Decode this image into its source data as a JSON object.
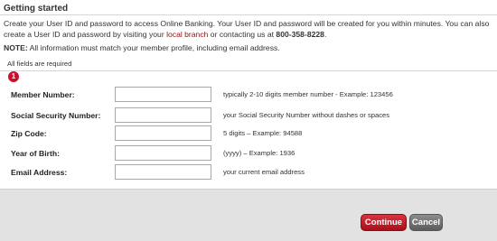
{
  "header": {
    "title": "Getting started"
  },
  "intro": {
    "text_before_link": "Create your User ID and password to access Online Banking. Your User ID and password will be created for you within minutes. You can also create a User ID and password by visiting your ",
    "link_text": "local branch",
    "text_after_link": " or contacting us at ",
    "phone": "800-358-8228",
    "end": "."
  },
  "note": {
    "label": "NOTE:",
    "text": " All information must match your member profile, including email address."
  },
  "required_text": "All fields are required",
  "step_badge": "1",
  "form": {
    "fields": [
      {
        "label": "Member Number:",
        "value": "",
        "hint": "typically 2-10 digits member number - Example: 123456"
      },
      {
        "label": "Social Security Number:",
        "value": "",
        "hint": "your Social Security Number without dashes or spaces"
      },
      {
        "label": "Zip Code:",
        "value": "",
        "hint": "5 digits – Example: 94588"
      },
      {
        "label": "Year of Birth:",
        "value": "",
        "hint": "(yyyy) – Example: 1936"
      },
      {
        "label": "Email Address:",
        "value": "",
        "hint": "your current email address"
      }
    ]
  },
  "buttons": {
    "continue_label": "Continue",
    "cancel_label": "Cancel"
  },
  "colors": {
    "accent": "#c8102e",
    "link": "#8a1010",
    "footer_bg": "#e2e2e2"
  }
}
